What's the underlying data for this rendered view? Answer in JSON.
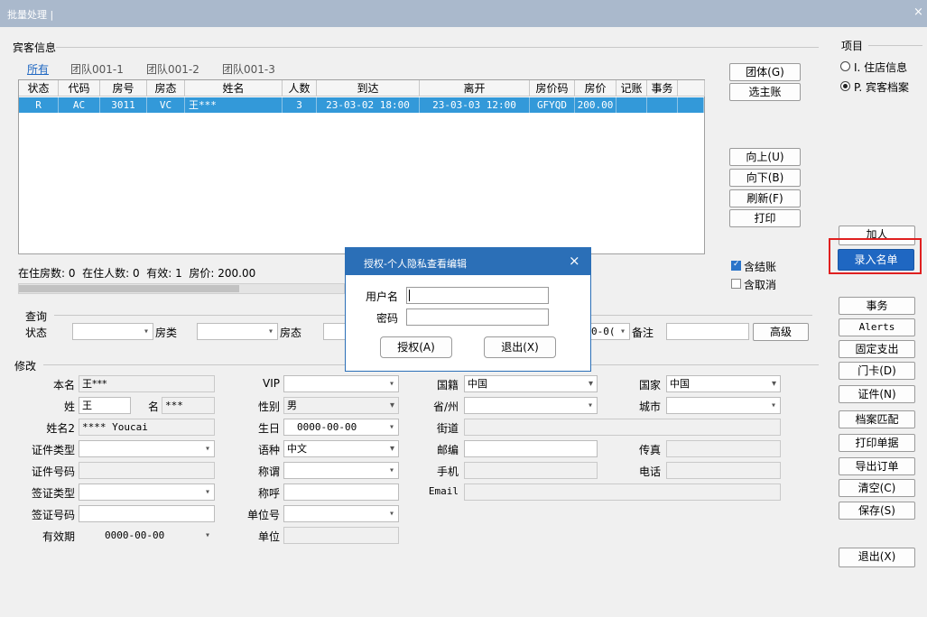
{
  "window": {
    "title": "批量处理 |  ",
    "close": "×"
  },
  "guest": {
    "section": "宾客信息",
    "tabs": [
      "所有",
      "团队001-1",
      "团队001-2",
      "团队001-3"
    ],
    "columns": [
      "状态",
      "代码",
      "房号",
      "房态",
      "姓名",
      "人数",
      "到达",
      "离开",
      "房价码",
      "房价",
      "记账",
      "事务"
    ],
    "row": [
      "R",
      "AC",
      "3011",
      "VC",
      "王***",
      "3",
      "23-03-02 18:00",
      "23-03-03 12:00",
      "GFYQD",
      "200.00",
      "",
      ""
    ],
    "summary": "在住房数: 0  在住人数: 0  有效: 1  房价: 200.00"
  },
  "side_buttons": {
    "group": "团体(G)",
    "main_acct": "选主账",
    "up": "向上(U)",
    "down": "向下(B)",
    "refresh": "刷新(F)",
    "print": "打印"
  },
  "checks": {
    "incl_checkout": "含结账",
    "incl_cancel": "含取消"
  },
  "query": {
    "section": "查询",
    "status": "状态",
    "room_type": "房类",
    "room_state": "房态",
    "date_tail": "0-0(",
    "note": "备注",
    "advanced": "高级"
  },
  "modify": {
    "section": "修改",
    "labels": {
      "name": "本名",
      "surname": "姓",
      "given": "名",
      "name2": "姓名2",
      "id_type": "证件类型",
      "id_no": "证件号码",
      "visa_type": "签证类型",
      "visa_no": "签证号码",
      "valid": "有效期",
      "vip": "VIP",
      "gender": "性别",
      "birthday": "生日",
      "language": "语种",
      "title": "称谓",
      "salutation": "称呼",
      "company_no": "单位号",
      "company": "单位",
      "nationality": "国籍",
      "province": "省/州",
      "street": "街道",
      "zip": "邮编",
      "mobile": "手机",
      "email": "Email",
      "country": "国家",
      "city": "城市",
      "fax": "传真",
      "phone": "电话"
    },
    "values": {
      "name": "王***",
      "surname": "王",
      "given": "***",
      "name2": "**** Youcai",
      "valid": "0000-00-00",
      "gender": "男",
      "birthday": "0000-00-00",
      "language": "中文",
      "nationality": "中国",
      "country": "中国"
    }
  },
  "project": {
    "title": "项目",
    "opt1": "I. 住店信息",
    "opt2": "P. 宾客档案"
  },
  "right_buttons": {
    "add": "加人",
    "enter_list": "录入名单",
    "affairs": "事务",
    "alerts": "Alerts",
    "fixed": "固定支出",
    "card": "门卡(D)",
    "cert": "证件(N)",
    "match": "档案匹配",
    "print_bill": "打印单据",
    "export": "导出订单",
    "clear": "清空(C)",
    "save": "保存(S)",
    "exit": "退出(X)"
  },
  "dialog": {
    "title": "授权-个人隐私查看编辑",
    "close": "×",
    "user_label": "用户名",
    "pwd_label": "密码",
    "auth": "授权(A)",
    "exit": "退出(X)"
  },
  "colors": {
    "titlebar": "#aab9cc",
    "selected_row": "#3399d9",
    "dialog_header": "#2b6fb7",
    "highlight_border": "#e02020",
    "primary_button": "#1f67c2"
  }
}
